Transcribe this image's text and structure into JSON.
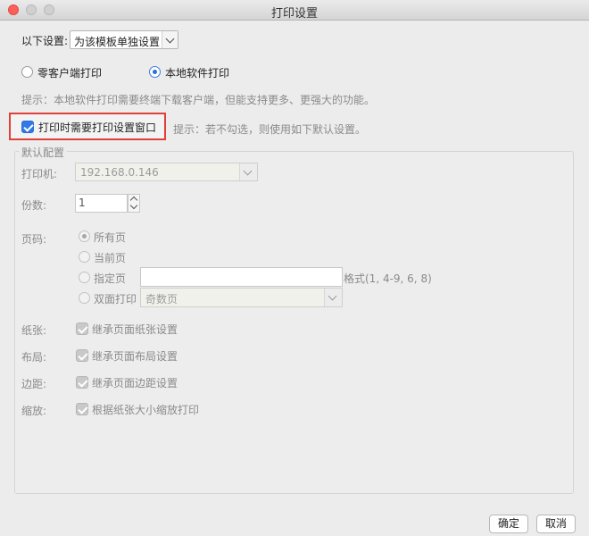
{
  "window": {
    "title": "打印设置"
  },
  "settings_scope": {
    "label": "以下设置:",
    "value": "为该模板单独设置"
  },
  "print_mode": {
    "options": [
      {
        "label": "零客户端打印",
        "selected": false
      },
      {
        "label": "本地软件打印",
        "selected": true
      }
    ],
    "hint": "提示：本地软件打印需要终端下载客户端，但能支持更多、更强大的功能。"
  },
  "need_dialog": {
    "label": "打印时需要打印设置窗口",
    "checked": true,
    "hint": "提示：若不勾选，则使用如下默认设置。"
  },
  "defaults": {
    "title": "默认配置",
    "printer": {
      "label": "打印机:",
      "value": "192.168.0.146"
    },
    "copies": {
      "label": "份数:",
      "value": "1"
    },
    "pages": {
      "label": "页码:",
      "all": "所有页",
      "current": "当前页",
      "specify": "指定页",
      "specify_value": "",
      "format_hint": "格式(1, 4-9, 6, 8)",
      "duplex": "双面打印",
      "duplex_value": "奇数页",
      "selected": "all"
    },
    "paper": {
      "label": "纸张:",
      "option": "继承页面纸张设置",
      "checked": true
    },
    "layout": {
      "label": "布局:",
      "option": "继承页面布局设置",
      "checked": true
    },
    "margin": {
      "label": "边距:",
      "option": "继承页面边距设置",
      "checked": true
    },
    "scale": {
      "label": "缩放:",
      "option": "根据纸张大小缩放打印",
      "checked": true
    }
  },
  "buttons": {
    "ok": "确定",
    "cancel": "取消"
  }
}
